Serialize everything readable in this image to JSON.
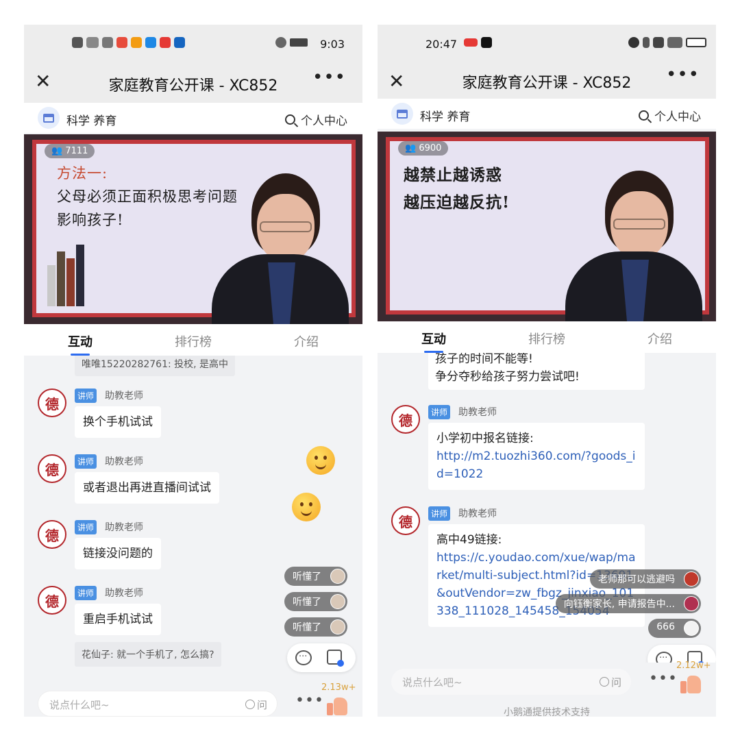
{
  "left": {
    "status": {
      "time": "9:03"
    },
    "header": {
      "title": "家庭教育公开课 - XC852"
    },
    "subheader": {
      "section": "科学 养育",
      "personal": "个人中心"
    },
    "video": {
      "viewers": "7111",
      "board_lines": [
        "方法一:",
        "父母必须正面积极思考问题",
        "影响孩子!"
      ]
    },
    "tabs": [
      "互动",
      "排行榜",
      "介绍"
    ],
    "chat": {
      "top_snippet": "唯唯15220282761: 投校, 是高中",
      "messages": [
        {
          "badge": "讲师",
          "sender": "助教老师",
          "text": "换个手机试试"
        },
        {
          "badge": "讲师",
          "sender": "助教老师",
          "text": "或者退出再进直播间试试"
        },
        {
          "badge": "讲师",
          "sender": "助教老师",
          "text": "链接没问题的"
        },
        {
          "badge": "讲师",
          "sender": "助教老师",
          "text": "重启手机试试"
        }
      ],
      "bottom_snippet": "花仙子: 就一个手机了, 怎么搞?"
    },
    "reactions": [
      "听懂了",
      "听懂了",
      "听懂了"
    ],
    "input": {
      "placeholder": "说点什么吧~",
      "ask": "问"
    },
    "likes": "2.13w+"
  },
  "right": {
    "status": {
      "time": "20:47"
    },
    "header": {
      "title": "家庭教育公开课 - XC852"
    },
    "subheader": {
      "section": "科学 养育",
      "personal": "个人中心"
    },
    "video": {
      "viewers": "6900",
      "board_lines": [
        "越禁止越诱惑",
        "越压迫越反抗!"
      ]
    },
    "tabs": [
      "互动",
      "排行榜",
      "介绍"
    ],
    "chat": {
      "top_bubble": [
        "孩子的时间不能等!",
        "争分夺秒给孩子努力尝试吧!"
      ],
      "msg1": {
        "badge": "讲师",
        "sender": "助教老师",
        "line1": "小学初中报名链接:",
        "link": "http://m2.tuozhi360.com/?goods_id=1022"
      },
      "msg2": {
        "badge": "讲师",
        "sender": "助教老师",
        "line1": "高中49链接:",
        "link": "https://c.youdao.com/xue/wap/market/multi-subject.html?id=13691&outVendor=zw_fbgz_jinxiao_101338_111028_145458_154054"
      }
    },
    "reactions": [
      "老师那可以逃避吗",
      "向钰衡家长, 申请报告中...",
      "666"
    ],
    "input": {
      "placeholder": "说点什么吧~",
      "ask": "问"
    },
    "likes": "2.12w+",
    "footer": "小鹅通提供技术支持"
  }
}
